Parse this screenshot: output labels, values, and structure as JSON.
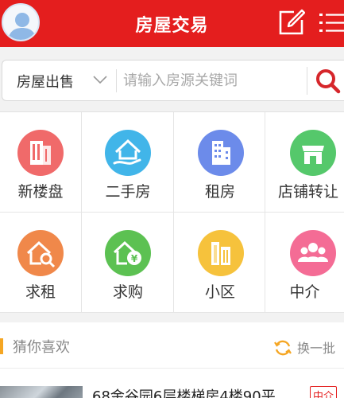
{
  "header": {
    "title": "房屋交易"
  },
  "search": {
    "type_label": "房屋出售",
    "placeholder": "请输入房源关键词"
  },
  "grid": [
    {
      "label": "新楼盘",
      "color": "#f06a6a",
      "icon": "building-icon"
    },
    {
      "label": "二手房",
      "color": "#41b5e9",
      "icon": "house-hand-icon"
    },
    {
      "label": "租房",
      "color": "#6c8bea",
      "icon": "apartment-icon"
    },
    {
      "label": "店铺转让",
      "color": "#55c86b",
      "icon": "shop-icon"
    },
    {
      "label": "求租",
      "color": "#f0884a",
      "icon": "house-key-icon"
    },
    {
      "label": "求购",
      "color": "#5cc152",
      "icon": "house-yen-icon"
    },
    {
      "label": "小区",
      "color": "#f6c23c",
      "icon": "community-icon"
    },
    {
      "label": "中介",
      "color": "#f46c95",
      "icon": "agents-icon"
    }
  ],
  "recommend": {
    "title": "猜你喜欢",
    "refresh_label": "换一批"
  },
  "listing": {
    "title": "68金谷园6层楼梯房4楼90平",
    "badge": "中介"
  },
  "colors": {
    "brand": "#e41e1e",
    "accent": "#f5a623"
  }
}
